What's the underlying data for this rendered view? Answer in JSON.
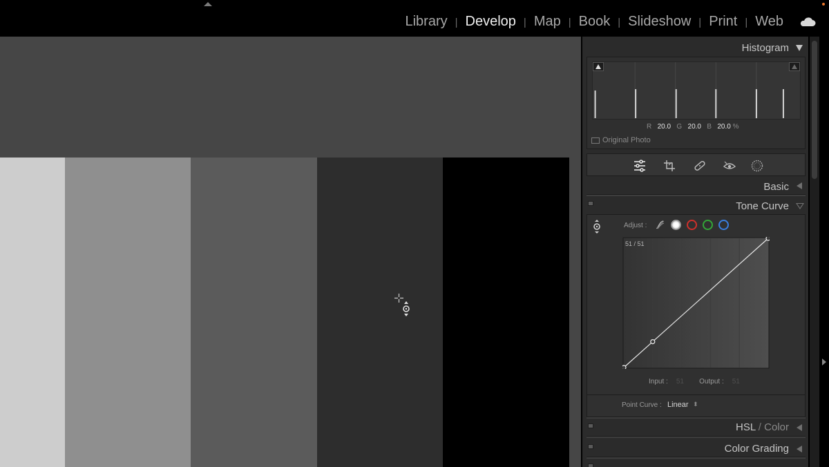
{
  "modules": [
    "Library",
    "Develop",
    "Map",
    "Book",
    "Slideshow",
    "Print",
    "Web"
  ],
  "active_module": "Develop",
  "module_separator": "|",
  "icons": {
    "collapse": "triangle-up-icon",
    "cloud": "cloud-icon",
    "tools": [
      "sliders-icon",
      "crop-icon",
      "healing-icon",
      "red-eye-icon",
      "masking-icon"
    ]
  },
  "colors": {
    "swatches": [
      "#cdcdcd",
      "#8f8f8f",
      "#5b5b5b",
      "#2d2d2d",
      "#000000"
    ],
    "viewer_bg": "#464646",
    "channel_red": "#d0302b",
    "channel_green": "#33a737",
    "channel_blue": "#3a7fe0",
    "notification": "#e8752a"
  },
  "histogram": {
    "title": "Histogram",
    "r_label": "R",
    "r_value": "20.0",
    "g_label": "G",
    "g_value": "20.0",
    "b_label": "B",
    "b_value": "20.0",
    "unit": "%",
    "original_photo": "Original Photo"
  },
  "basic": {
    "title": "Basic"
  },
  "tone_curve": {
    "title": "Tone Curve",
    "adjust_label": "Adjust :",
    "readout": "51 / 51",
    "input_label": "Input :",
    "input_value": "51",
    "output_label": "Output :",
    "output_value": "51",
    "point_curve_label": "Point Curve :",
    "point_curve_value": "Linear",
    "curve_points": [
      [
        0,
        0
      ],
      [
        51,
        51
      ],
      [
        255,
        255
      ]
    ]
  },
  "hsl": {
    "title_hsl": "HSL",
    "slash": " / ",
    "title_color": "Color"
  },
  "color_grading": {
    "title": "Color Grading"
  }
}
